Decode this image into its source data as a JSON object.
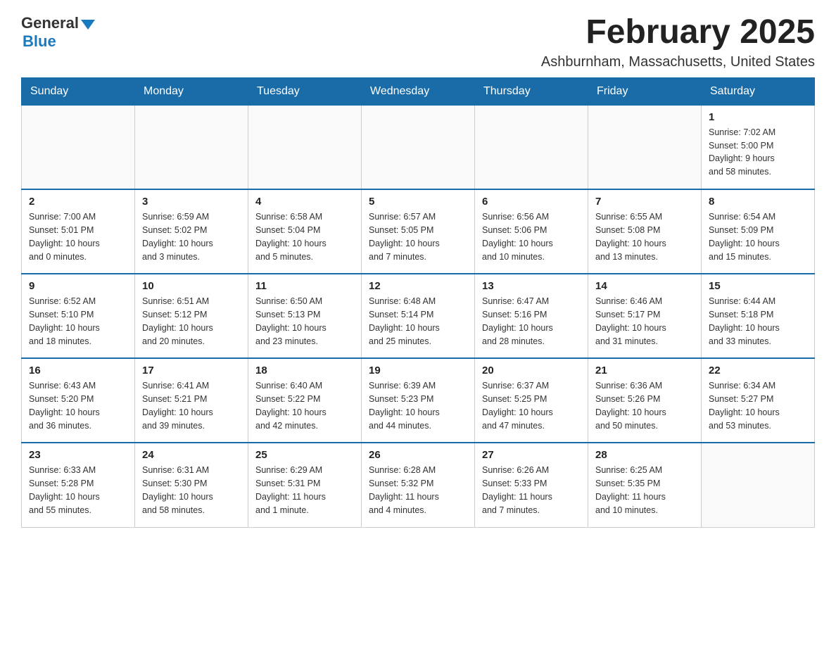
{
  "header": {
    "logo_general": "General",
    "logo_blue": "Blue",
    "title": "February 2025",
    "subtitle": "Ashburnham, Massachusetts, United States"
  },
  "weekdays": [
    "Sunday",
    "Monday",
    "Tuesday",
    "Wednesday",
    "Thursday",
    "Friday",
    "Saturday"
  ],
  "weeks": [
    [
      {
        "day": "",
        "info": ""
      },
      {
        "day": "",
        "info": ""
      },
      {
        "day": "",
        "info": ""
      },
      {
        "day": "",
        "info": ""
      },
      {
        "day": "",
        "info": ""
      },
      {
        "day": "",
        "info": ""
      },
      {
        "day": "1",
        "info": "Sunrise: 7:02 AM\nSunset: 5:00 PM\nDaylight: 9 hours\nand 58 minutes."
      }
    ],
    [
      {
        "day": "2",
        "info": "Sunrise: 7:00 AM\nSunset: 5:01 PM\nDaylight: 10 hours\nand 0 minutes."
      },
      {
        "day": "3",
        "info": "Sunrise: 6:59 AM\nSunset: 5:02 PM\nDaylight: 10 hours\nand 3 minutes."
      },
      {
        "day": "4",
        "info": "Sunrise: 6:58 AM\nSunset: 5:04 PM\nDaylight: 10 hours\nand 5 minutes."
      },
      {
        "day": "5",
        "info": "Sunrise: 6:57 AM\nSunset: 5:05 PM\nDaylight: 10 hours\nand 7 minutes."
      },
      {
        "day": "6",
        "info": "Sunrise: 6:56 AM\nSunset: 5:06 PM\nDaylight: 10 hours\nand 10 minutes."
      },
      {
        "day": "7",
        "info": "Sunrise: 6:55 AM\nSunset: 5:08 PM\nDaylight: 10 hours\nand 13 minutes."
      },
      {
        "day": "8",
        "info": "Sunrise: 6:54 AM\nSunset: 5:09 PM\nDaylight: 10 hours\nand 15 minutes."
      }
    ],
    [
      {
        "day": "9",
        "info": "Sunrise: 6:52 AM\nSunset: 5:10 PM\nDaylight: 10 hours\nand 18 minutes."
      },
      {
        "day": "10",
        "info": "Sunrise: 6:51 AM\nSunset: 5:12 PM\nDaylight: 10 hours\nand 20 minutes."
      },
      {
        "day": "11",
        "info": "Sunrise: 6:50 AM\nSunset: 5:13 PM\nDaylight: 10 hours\nand 23 minutes."
      },
      {
        "day": "12",
        "info": "Sunrise: 6:48 AM\nSunset: 5:14 PM\nDaylight: 10 hours\nand 25 minutes."
      },
      {
        "day": "13",
        "info": "Sunrise: 6:47 AM\nSunset: 5:16 PM\nDaylight: 10 hours\nand 28 minutes."
      },
      {
        "day": "14",
        "info": "Sunrise: 6:46 AM\nSunset: 5:17 PM\nDaylight: 10 hours\nand 31 minutes."
      },
      {
        "day": "15",
        "info": "Sunrise: 6:44 AM\nSunset: 5:18 PM\nDaylight: 10 hours\nand 33 minutes."
      }
    ],
    [
      {
        "day": "16",
        "info": "Sunrise: 6:43 AM\nSunset: 5:20 PM\nDaylight: 10 hours\nand 36 minutes."
      },
      {
        "day": "17",
        "info": "Sunrise: 6:41 AM\nSunset: 5:21 PM\nDaylight: 10 hours\nand 39 minutes."
      },
      {
        "day": "18",
        "info": "Sunrise: 6:40 AM\nSunset: 5:22 PM\nDaylight: 10 hours\nand 42 minutes."
      },
      {
        "day": "19",
        "info": "Sunrise: 6:39 AM\nSunset: 5:23 PM\nDaylight: 10 hours\nand 44 minutes."
      },
      {
        "day": "20",
        "info": "Sunrise: 6:37 AM\nSunset: 5:25 PM\nDaylight: 10 hours\nand 47 minutes."
      },
      {
        "day": "21",
        "info": "Sunrise: 6:36 AM\nSunset: 5:26 PM\nDaylight: 10 hours\nand 50 minutes."
      },
      {
        "day": "22",
        "info": "Sunrise: 6:34 AM\nSunset: 5:27 PM\nDaylight: 10 hours\nand 53 minutes."
      }
    ],
    [
      {
        "day": "23",
        "info": "Sunrise: 6:33 AM\nSunset: 5:28 PM\nDaylight: 10 hours\nand 55 minutes."
      },
      {
        "day": "24",
        "info": "Sunrise: 6:31 AM\nSunset: 5:30 PM\nDaylight: 10 hours\nand 58 minutes."
      },
      {
        "day": "25",
        "info": "Sunrise: 6:29 AM\nSunset: 5:31 PM\nDaylight: 11 hours\nand 1 minute."
      },
      {
        "day": "26",
        "info": "Sunrise: 6:28 AM\nSunset: 5:32 PM\nDaylight: 11 hours\nand 4 minutes."
      },
      {
        "day": "27",
        "info": "Sunrise: 6:26 AM\nSunset: 5:33 PM\nDaylight: 11 hours\nand 7 minutes."
      },
      {
        "day": "28",
        "info": "Sunrise: 6:25 AM\nSunset: 5:35 PM\nDaylight: 11 hours\nand 10 minutes."
      },
      {
        "day": "",
        "info": ""
      }
    ]
  ]
}
